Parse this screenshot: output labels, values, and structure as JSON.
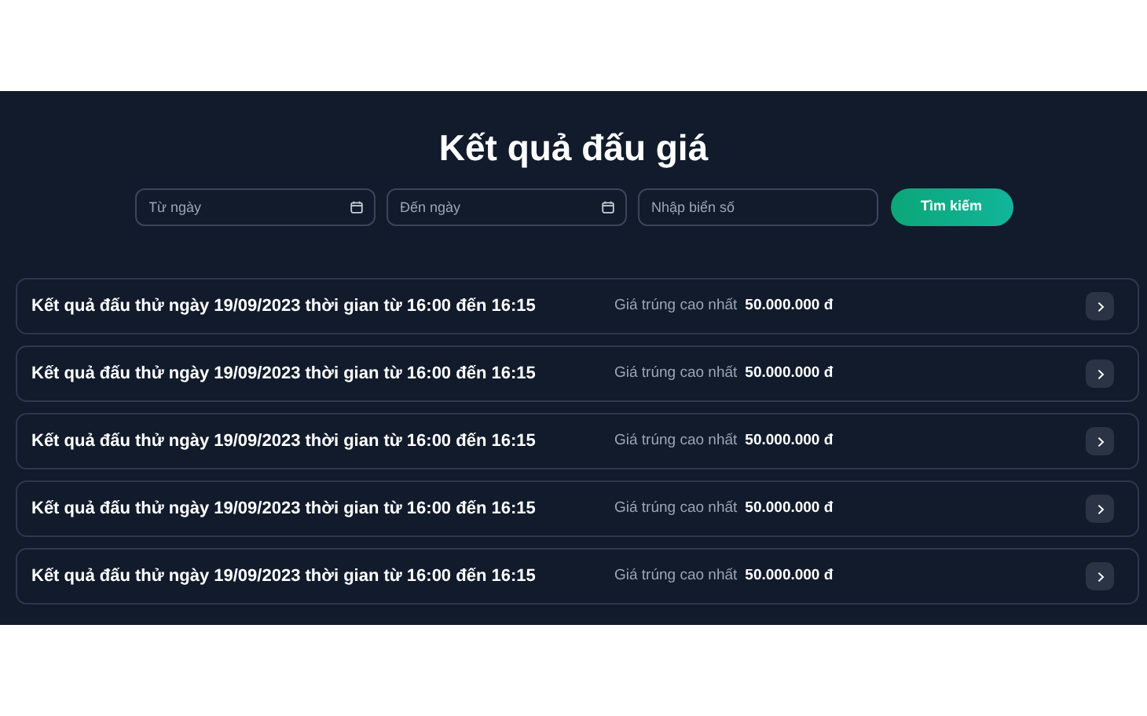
{
  "title": "Kết quả đấu giá",
  "filters": {
    "from": {
      "placeholder": "Từ ngày"
    },
    "to": {
      "placeholder": "Đến ngày"
    },
    "plate": {
      "placeholder": "Nhập biển số"
    },
    "button": "Tìm kiếm"
  },
  "results": [
    {
      "title": "Kết quả đấu thử ngày 19/09/2023 thời gian từ 16:00 đến 16:15",
      "price_label": "Giá trúng cao nhất",
      "price": "50.000.000 đ"
    },
    {
      "title": "Kết quả đấu thử ngày 19/09/2023 thời gian từ 16:00 đến 16:15",
      "price_label": "Giá trúng cao nhất",
      "price": "50.000.000 đ"
    },
    {
      "title": "Kết quả đấu thử ngày 19/09/2023 thời gian từ 16:00 đến 16:15",
      "price_label": "Giá trúng cao nhất",
      "price": "50.000.000 đ"
    },
    {
      "title": "Kết quả đấu thử ngày 19/09/2023 thời gian từ 16:00 đến 16:15",
      "price_label": "Giá trúng cao nhất",
      "price": "50.000.000 đ"
    },
    {
      "title": "Kết quả đấu thử ngày 19/09/2023 thời gian từ 16:00 đến 16:15",
      "price_label": "Giá trúng cao nhất",
      "price": "50.000.000 đ"
    }
  ]
}
